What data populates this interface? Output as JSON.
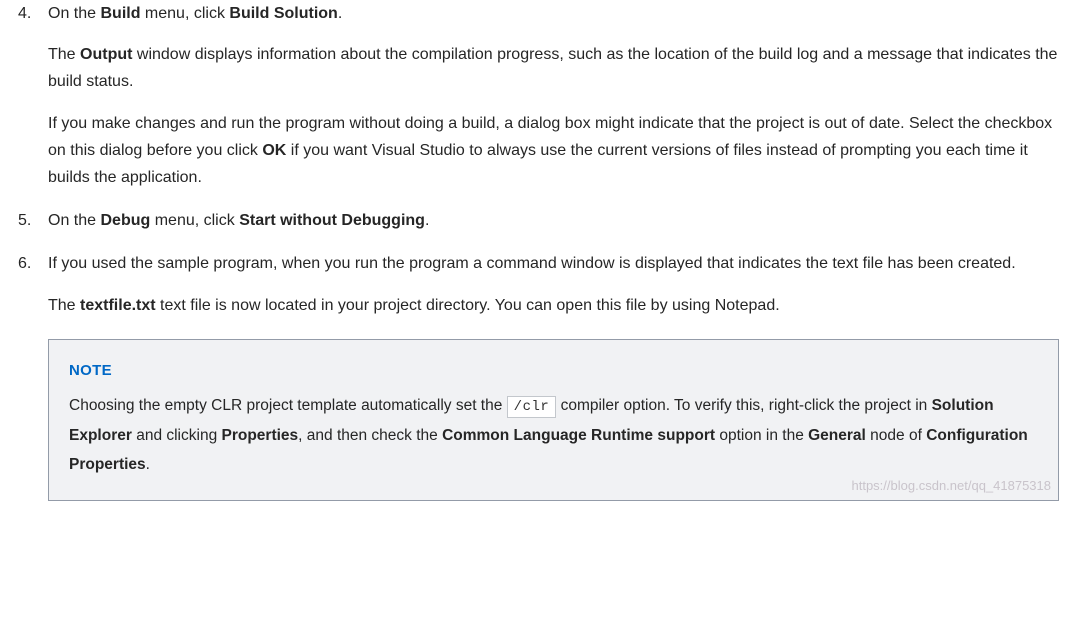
{
  "steps": [
    {
      "num": "4.",
      "paragraphs": [
        {
          "runs": [
            {
              "t": "On the "
            },
            {
              "t": "Build",
              "bold": true
            },
            {
              "t": " menu, click "
            },
            {
              "t": "Build Solution",
              "bold": true
            },
            {
              "t": "."
            }
          ]
        },
        {
          "runs": [
            {
              "t": "The "
            },
            {
              "t": "Output",
              "bold": true
            },
            {
              "t": " window displays information about the compilation progress, such as the location of the build log and a message that indicates the build status."
            }
          ]
        },
        {
          "runs": [
            {
              "t": "If you make changes and run the program without doing a build, a dialog box might indicate that the project is out of date. Select the checkbox on this dialog before you click "
            },
            {
              "t": "OK",
              "bold": true
            },
            {
              "t": " if you want Visual Studio to always use the current versions of files instead of prompting you each time it builds the application."
            }
          ]
        }
      ]
    },
    {
      "num": "5.",
      "paragraphs": [
        {
          "runs": [
            {
              "t": "On the "
            },
            {
              "t": "Debug",
              "bold": true
            },
            {
              "t": " menu, click "
            },
            {
              "t": "Start without Debugging",
              "bold": true
            },
            {
              "t": "."
            }
          ]
        }
      ]
    },
    {
      "num": "6.",
      "paragraphs": [
        {
          "runs": [
            {
              "t": "If you used the sample program, when you run the program a command window is displayed that indicates the text file has been created."
            }
          ]
        },
        {
          "runs": [
            {
              "t": "The "
            },
            {
              "t": "textfile.txt",
              "bold": true
            },
            {
              "t": " text file is now located in your project directory. You can open this file by using Notepad."
            }
          ]
        }
      ]
    }
  ],
  "note": {
    "title": "NOTE",
    "body_runs": [
      {
        "t": "Choosing the empty CLR project template automatically set the "
      },
      {
        "t": "/clr",
        "code": true
      },
      {
        "t": " compiler option. To verify this, right-click the project in "
      },
      {
        "t": "Solution Explorer",
        "bold": true
      },
      {
        "t": " and clicking "
      },
      {
        "t": "Properties",
        "bold": true
      },
      {
        "t": ", and then check the "
      },
      {
        "t": "Common Language Runtime support",
        "bold": true
      },
      {
        "t": " option in the "
      },
      {
        "t": "General",
        "bold": true
      },
      {
        "t": " node of "
      },
      {
        "t": "Configuration Properties",
        "bold": true
      },
      {
        "t": "."
      }
    ]
  },
  "watermark": "https://blog.csdn.net/qq_41875318"
}
